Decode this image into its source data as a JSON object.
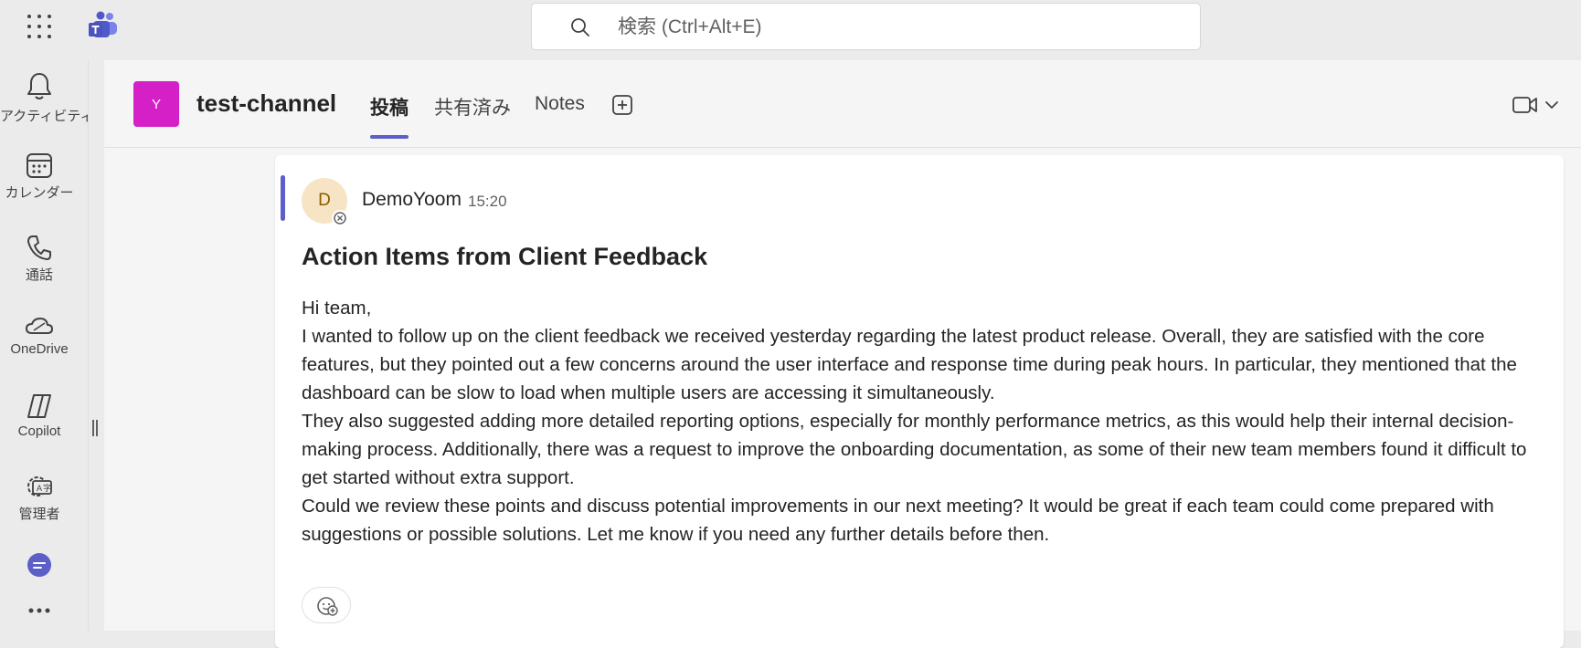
{
  "search": {
    "placeholder": "検索 (Ctrl+Alt+E)"
  },
  "icons": {
    "app_launcher": "waffle-icon",
    "app_logo": "teams-logo-icon",
    "search": "search-icon"
  },
  "rail": {
    "items": [
      {
        "label": "アクティビティ",
        "icon": "bell-icon"
      },
      {
        "label": "カレンダー",
        "icon": "calendar-icon"
      },
      {
        "label": "通話",
        "icon": "phone-icon"
      },
      {
        "label": "OneDrive",
        "icon": "cloud-icon"
      },
      {
        "label": "Copilot",
        "icon": "copilot-icon"
      },
      {
        "label": "管理者",
        "icon": "admin-gear-icon"
      }
    ]
  },
  "channel": {
    "team_initial": "Y",
    "team_color": "#d520c8",
    "name": "test-channel",
    "tabs": [
      {
        "label": "投稿",
        "active": true
      },
      {
        "label": "共有済み",
        "active": false
      },
      {
        "label": "Notes",
        "active": false
      }
    ]
  },
  "post": {
    "author_initial": "D",
    "author": "DemoYoom",
    "time": "15:20",
    "subject": "Action Items from Client Feedback",
    "paragraphs": [
      "Hi team,",
      "I wanted to follow up on the client feedback we received yesterday regarding the latest product release. Overall, they are satisfied with the core features, but they pointed out a few concerns around the user interface and response time during peak hours. In particular, they mentioned that the dashboard can be slow to load when multiple users are accessing it simultaneously.",
      "They also suggested adding more detailed reporting options, especially for monthly performance metrics, as this would help their internal decision-making process. Additionally, there was a request to improve the onboarding documentation, as some of their new team members found it difficult to get started without extra support.",
      "Could we review these points and discuss potential improvements in our next meeting? It would be great if each team could come prepared with suggestions or possible solutions. Let me know if you need any further details before then."
    ]
  },
  "colors": {
    "accent": "#5b5fc7",
    "team_avatar": "#d520c8",
    "author_avatar_bg": "#f7e4c4"
  }
}
